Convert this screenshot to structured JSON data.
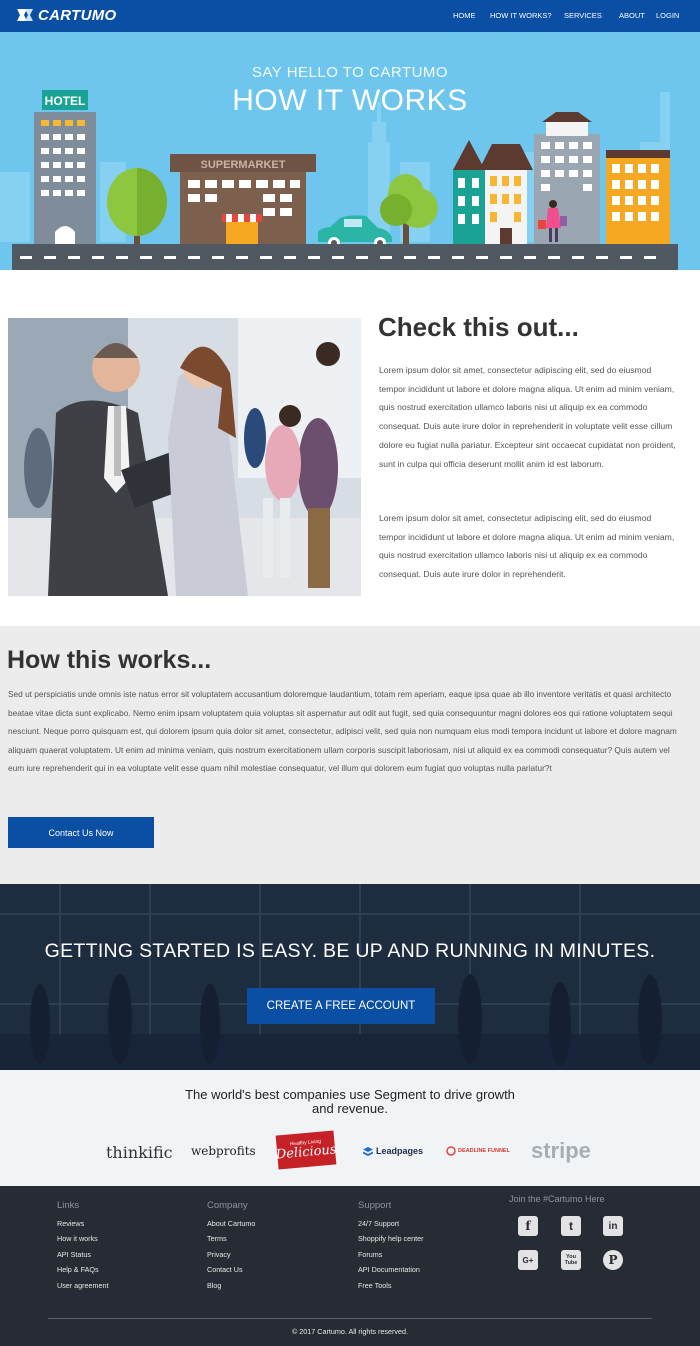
{
  "brand": {
    "name": "CARTUMO"
  },
  "nav": [
    "HOME",
    "HOW IT WORKS?",
    "SERVICES",
    "ABOUT",
    "LOGIN"
  ],
  "hero": {
    "kicker": "SAY HELLO TO CARTUMO",
    "title": "HOW IT WORKS",
    "hotel_sign": "HOTEL",
    "supermarket_sign": "SUPERMARKET"
  },
  "check": {
    "title": "Check this out...",
    "p1": "Lorem ipsum dolor sit amet, consectetur adipiscing elit, sed do eiusmod tempor incididunt ut labore et dolore magna aliqua. Ut enim ad minim veniam, quis nostrud exercitation ullamco laboris nisi ut aliquip ex ea commodo consequat. Duis aute irure dolor in reprehenderit in voluptate velit esse cillum dolore eu fugiat nulla pariatur. Excepteur sint occaecat cupidatat non proident, sunt in culpa qui officia deserunt mollit anim id est laborum.",
    "p2": "Lorem ipsum dolor sit amet, consectetur adipiscing elit, sed do eiusmod tempor incididunt ut labore et dolore magna aliqua. Ut enim ad minim veniam, quis nostrud exercitation ullamco laboris nisi ut aliquip ex ea commodo consequat. Duis aute irure dolor in reprehenderit."
  },
  "how": {
    "title": "How this works...",
    "body": "Sed ut perspiciatis unde omnis iste natus error sit voluptatem accusantium doloremque laudantium, totam rem aperiam, eaque ipsa quae ab illo inventore veritatis et quasi architecto beatae vitae dicta sunt explicabo. Nemo enim ipsam voluptatem quia voluptas sit aspernatur aut odit aut fugit, sed quia consequuntur magni dolores eos qui ratione voluptatem sequi nesciunt. Neque porro quisquam est, qui dolorem ipsum quia dolor sit amet, consectetur, adipisci velit, sed quia non numquam eius modi tempora incidunt ut labore et dolore magnam aliquam quaerat voluptatem. Ut enim ad minima veniam, quis nostrum exercitationem ullam corporis suscipit laboriosam, nisi ut aliquid ex ea commodi consequatur? Quis autem vel eum iure reprehenderit qui in ea voluptate velit esse quam nihil molestiae consequatur, vel illum qui dolorem eum fugiat quo voluptas nulla pariatur?t",
    "button": "Contact Us Now"
  },
  "cta": {
    "title": "GETTING STARTED IS EASY. BE UP AND RUNNING IN MINUTES.",
    "button": "CREATE A FREE ACCOUNT"
  },
  "companies": {
    "title": "The world's best companies use Segment to drive growth and revenue.",
    "logos": [
      "thinkific",
      "webprofits",
      "Delicious",
      "Leadpages",
      "DEADLINE FUNNEL",
      "stripe"
    ],
    "delicious_small": "Healthy Living"
  },
  "footer": {
    "columns": [
      {
        "title": "Links",
        "items": [
          "Reviews",
          "How it works",
          "API Status",
          "Help & FAQs",
          "User agreement"
        ]
      },
      {
        "title": "Company",
        "items": [
          "About Cartumo",
          "Terms",
          "Privacy",
          "Contact Us",
          "Blog"
        ]
      },
      {
        "title": "Support",
        "items": [
          "24/7 Support",
          "Shoppify help center",
          "Forums",
          "API Documentation",
          "Free Tools"
        ]
      }
    ],
    "social_title": "Join the #Cartumo Here",
    "social": [
      "facebook-icon",
      "twitter-icon",
      "linkedin-icon",
      "google-plus-icon",
      "youtube-icon",
      "pinterest-icon"
    ],
    "social_glyphs": [
      "f",
      "t",
      "in",
      "G+",
      "You Tube",
      "P"
    ],
    "copyright": "© 2017 Cartumo. All rights reserved."
  },
  "colors": {
    "brand_blue": "#0a4fa3",
    "hero_sky": "#6ec6ef",
    "footer_bg": "#272b33",
    "cta_bg": "#1d2b3e"
  }
}
